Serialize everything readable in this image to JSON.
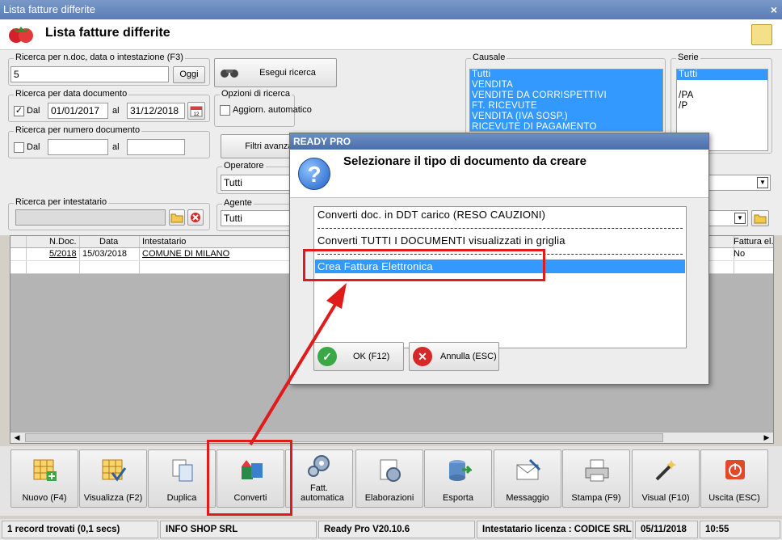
{
  "window": {
    "title": "Lista fatture differite",
    "close_label": "×"
  },
  "header": {
    "title": "Lista fatture differite"
  },
  "search": {
    "group_label": "Ricerca per n.doc, data o intestazione (F3)",
    "value": "5",
    "oggi_label": "Oggi",
    "esegui_label": "Esegui ricerca"
  },
  "date_search": {
    "group_label": "Ricerca per data documento",
    "dal_label": "Dal",
    "dal_checked": "✓",
    "from": "01/01/2017",
    "al_label": "al",
    "to": "31/12/2018"
  },
  "number_search": {
    "group_label": "Ricerca per numero documento",
    "dal_label": "Dal",
    "al_label": "al"
  },
  "options": {
    "group_label": "Opzioni di ricerca",
    "auto_label": "Aggiorn. automatico",
    "filtri_label": "Filtri avanzati"
  },
  "operatore": {
    "label": "Operatore",
    "value": "Tutti"
  },
  "agente": {
    "label": "Agente",
    "value": "Tutti"
  },
  "intestatario": {
    "label": "Ricerca per intestatario"
  },
  "causale": {
    "label": "Causale",
    "items": [
      "Tutti",
      "VENDITA",
      "VENDITE DA CORRISPETTIVI",
      "FT. RICEVUTE",
      "VENDITA (IVA SOSP.)",
      "RICEVUTE DI PAGAMENTO"
    ]
  },
  "serie": {
    "label": "Serie",
    "items": [
      "Tutti",
      "",
      "/PA",
      "/P"
    ]
  },
  "grid": {
    "columns": [
      "N.Doc.",
      "Data",
      "Intestatario",
      "Fattura el."
    ],
    "rows": [
      {
        "ndoc": "5/2018",
        "data": "15/03/2018",
        "intestatario": "COMUNE DI MILANO",
        "fattura_el": "No"
      }
    ]
  },
  "toolbar": {
    "buttons": [
      {
        "label": "Nuovo (F4)"
      },
      {
        "label": "Visualizza (F2)"
      },
      {
        "label": "Duplica"
      },
      {
        "label": "Converti"
      },
      {
        "label": "Fatt. automatica"
      },
      {
        "label": "Elaborazioni"
      },
      {
        "label": "Esporta"
      },
      {
        "label": "Messaggio"
      },
      {
        "label": "Stampa (F9)"
      },
      {
        "label": "Visual (F10)"
      },
      {
        "label": "Uscita (ESC)"
      }
    ]
  },
  "status": {
    "records": "1 record trovati (0,1 secs)",
    "company": "INFO SHOP SRL",
    "version": "Ready Pro V20.10.6",
    "license": "Intestatario licenza : CODICE SRL",
    "date": "05/11/2018",
    "time": "10:55"
  },
  "dialog": {
    "title": "READY PRO",
    "question": "Selezionare il tipo di documento da creare",
    "options": [
      "Converti doc. in DDT carico (RESO CAUZIONI)",
      "Converti TUTTI I DOCUMENTI visualizzati in griglia",
      "Crea Fattura Elettronica"
    ],
    "ok_label": "OK (F12)",
    "cancel_label": "Annulla (ESC)"
  },
  "colors": {
    "accent": "#3399ff",
    "highlight": "#e01b1b",
    "title_bar": "#5a7cb5"
  }
}
